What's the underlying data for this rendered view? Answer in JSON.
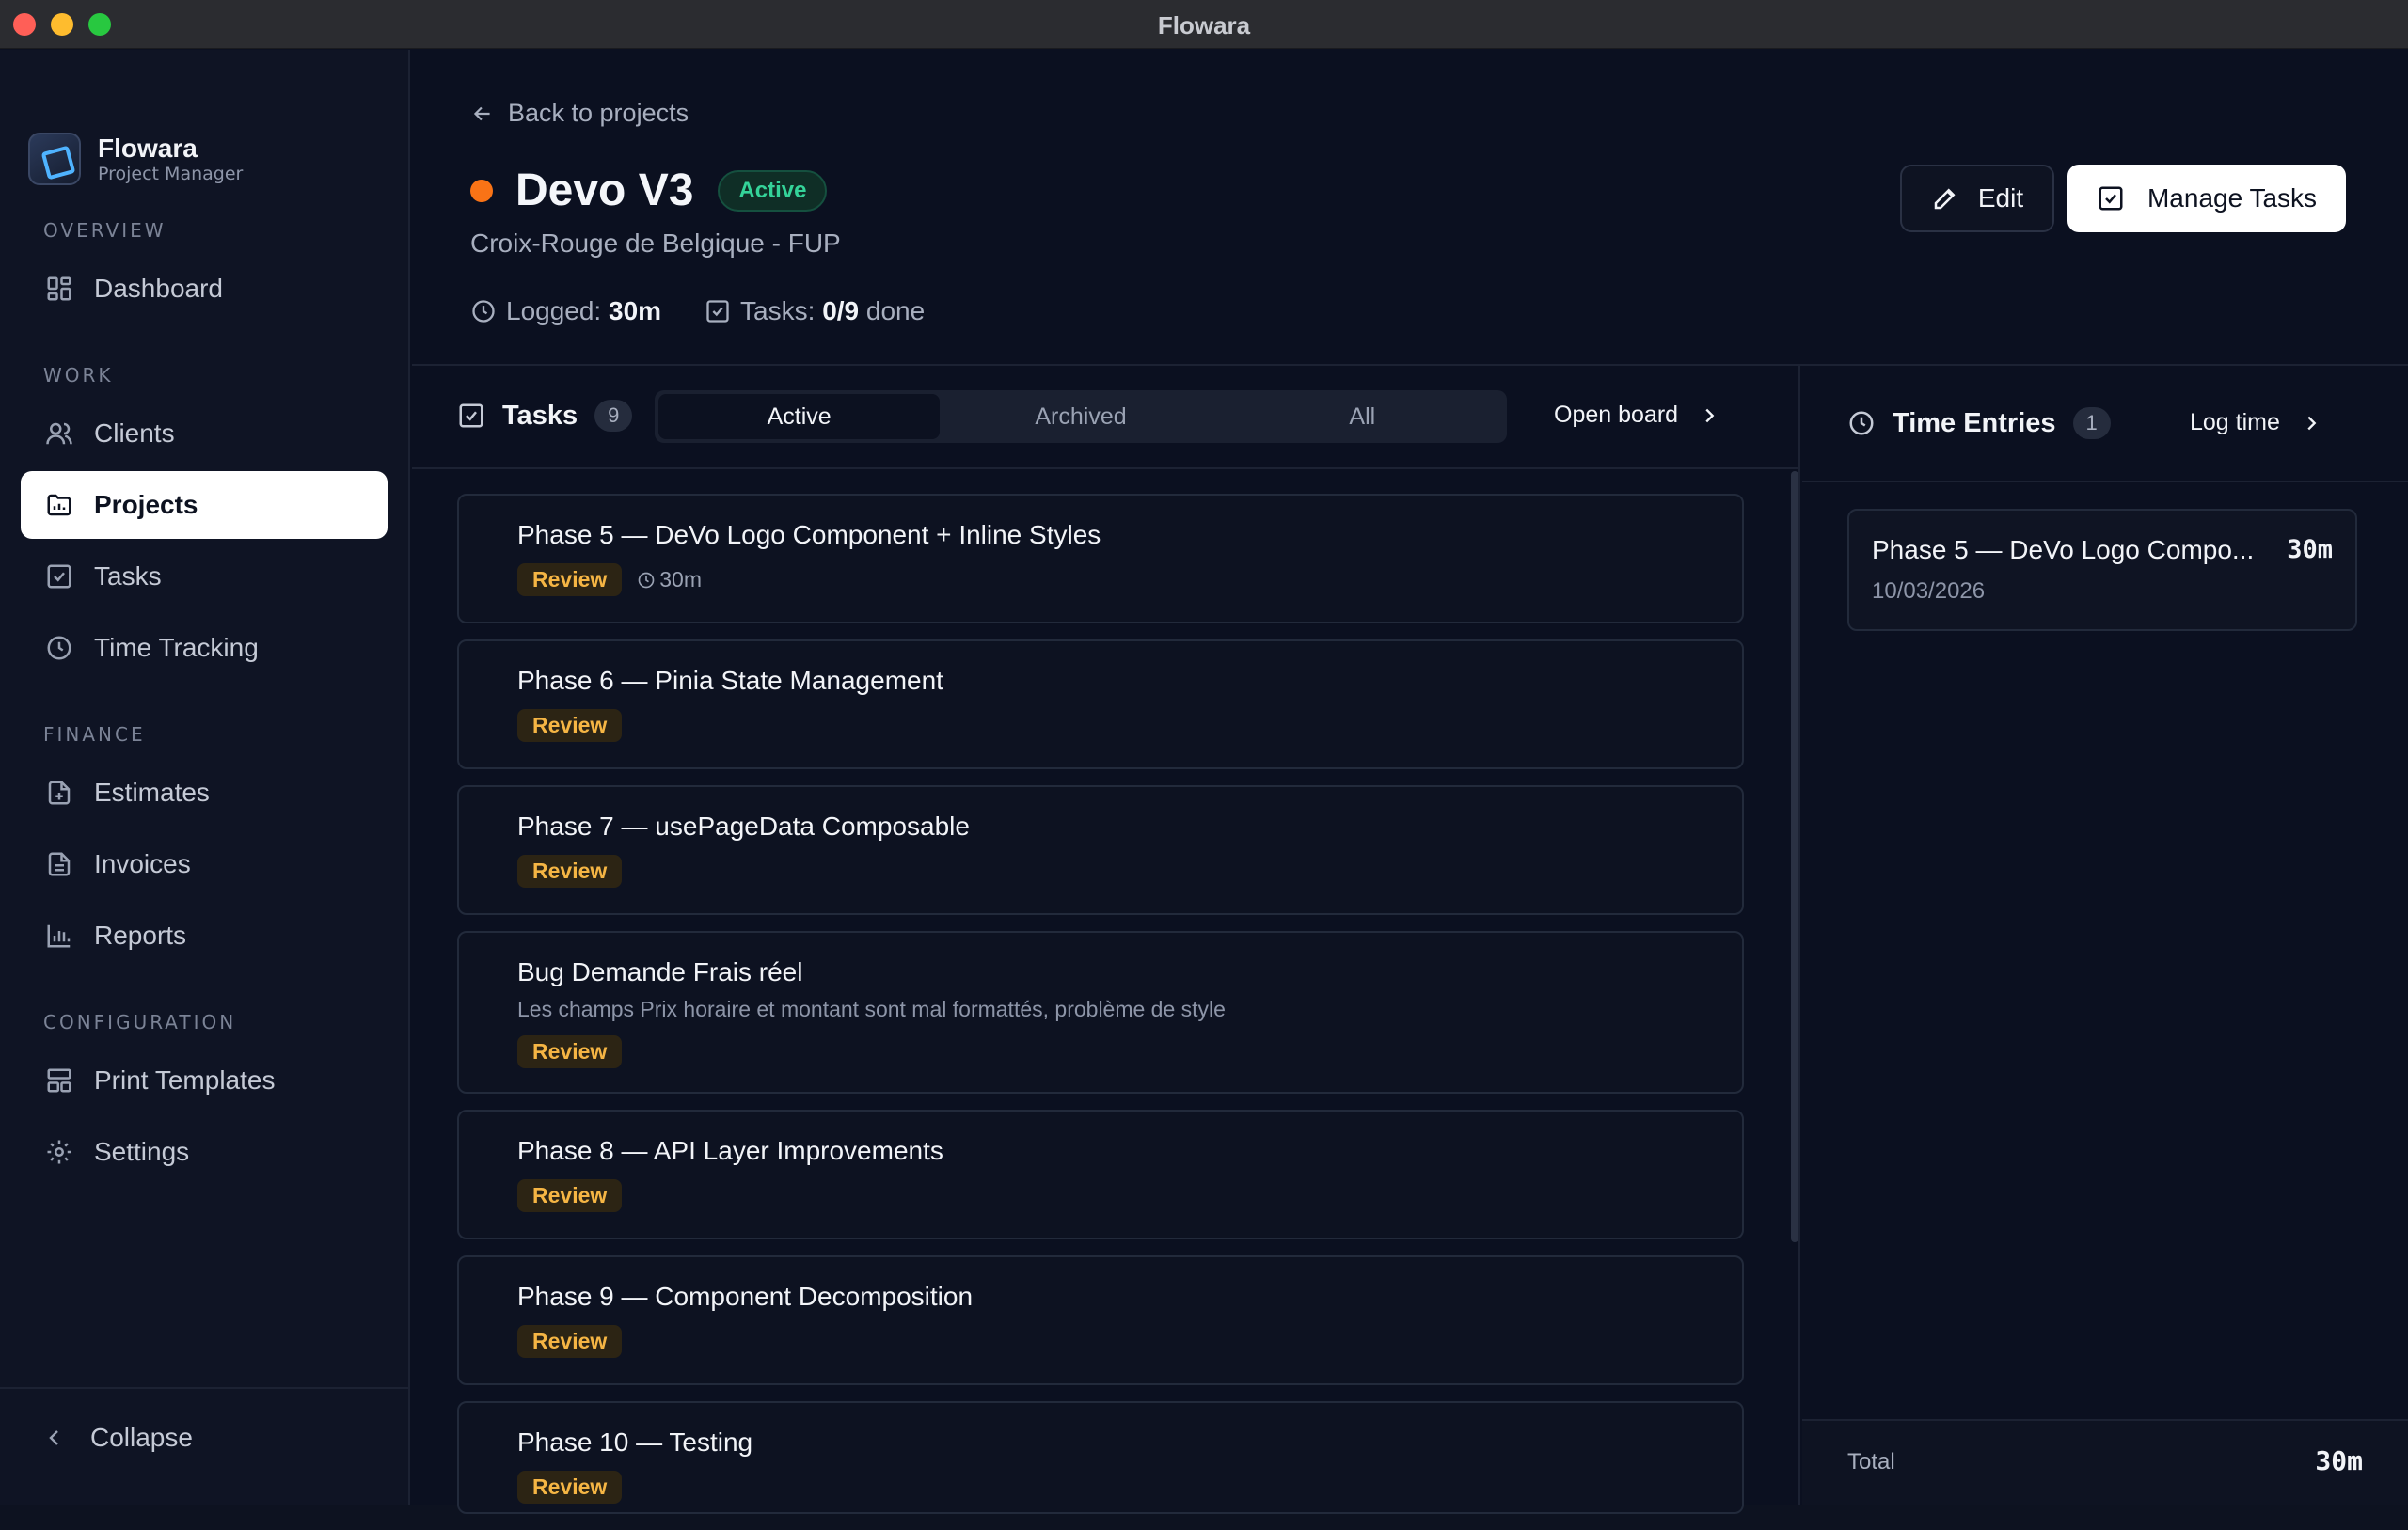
{
  "window": {
    "title": "Flowara"
  },
  "brand": {
    "name": "Flowara",
    "subtitle": "Project Manager"
  },
  "sidebar": {
    "sections": {
      "overview": "OVERVIEW",
      "work": "WORK",
      "finance": "FINANCE",
      "configuration": "CONFIGURATION"
    },
    "items": [
      {
        "label": "Dashboard",
        "icon": "grid-icon"
      },
      {
        "label": "Clients",
        "icon": "users-icon"
      },
      {
        "label": "Projects",
        "icon": "folder-chart-icon",
        "active": true
      },
      {
        "label": "Tasks",
        "icon": "checkbox-icon"
      },
      {
        "label": "Time Tracking",
        "icon": "clock-icon"
      },
      {
        "label": "Estimates",
        "icon": "file-plus-icon"
      },
      {
        "label": "Invoices",
        "icon": "file-text-icon"
      },
      {
        "label": "Reports",
        "icon": "bar-chart-icon"
      },
      {
        "label": "Print Templates",
        "icon": "layout-icon"
      },
      {
        "label": "Settings",
        "icon": "gear-icon"
      }
    ],
    "collapse_label": "Collapse"
  },
  "header": {
    "back_label": "Back to projects",
    "project_name": "Devo V3",
    "status": "Active",
    "status_color": "#34d399",
    "project_color": "#f97316",
    "client": "Croix-Rouge de Belgique - FUP",
    "logged_label": "Logged:",
    "logged_value": "30m",
    "tasks_label": "Tasks:",
    "tasks_value": "0/9",
    "tasks_suffix": "done",
    "edit_label": "Edit",
    "manage_label": "Manage Tasks"
  },
  "tasks_panel": {
    "title": "Tasks",
    "count": "9",
    "tabs": [
      "Active",
      "Archived",
      "All"
    ],
    "selected_tab": "Active",
    "open_board_label": "Open board",
    "tasks": [
      {
        "title": "Phase 5 — DeVo Logo Component + Inline Styles",
        "status": "Review",
        "time": "30m"
      },
      {
        "title": "Phase 6 — Pinia State Management",
        "status": "Review"
      },
      {
        "title": "Phase 7 — usePageData Composable",
        "status": "Review"
      },
      {
        "title": "Bug Demande Frais réel",
        "description": "Les champs Prix horaire et montant sont mal formattés, problème de style",
        "status": "Review"
      },
      {
        "title": "Phase 8 — API Layer Improvements",
        "status": "Review"
      },
      {
        "title": "Phase 9 — Component Decomposition",
        "status": "Review"
      },
      {
        "title": "Phase 10 — Testing",
        "status": "Review"
      }
    ]
  },
  "time_panel": {
    "title": "Time Entries",
    "count": "1",
    "log_time_label": "Log time",
    "entries": [
      {
        "title": "Phase 5 — DeVo Logo Compo...",
        "duration": "30m",
        "date": "10/03/2026"
      }
    ],
    "total_label": "Total",
    "total_value": "30m"
  }
}
